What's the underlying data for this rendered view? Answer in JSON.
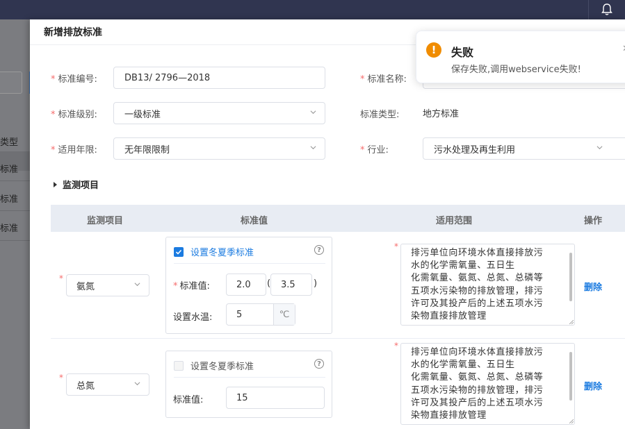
{
  "background": {
    "list_header": "类型",
    "rows": [
      "标准",
      "标准",
      "标准"
    ]
  },
  "drawer": {
    "title": "新增排放标准",
    "form": {
      "code_label": "标准编号:",
      "code_value": "DB13/ 2796—2018",
      "name_label": "标准名称:",
      "level_label": "标准级别:",
      "level_value": "一级标准",
      "type_label": "标准类型:",
      "type_value": "地方标准",
      "years_label": "适用年限:",
      "years_value": "无年限限制",
      "industry_label": "行业:",
      "industry_value": "污水处理及再生利用"
    },
    "section_title": "监测项目",
    "table": {
      "headers": [
        "监测项目",
        "标准值",
        "适用范围",
        "操作"
      ],
      "rows": [
        {
          "item": "氨氮",
          "winter_label": "设置冬夏季标准",
          "winter_checked": true,
          "value_label": "标准值:",
          "value_low": "2.0",
          "value_high": "3.5",
          "open_paren": "(",
          "close_paren": ")",
          "temp_label": "设置水温:",
          "temp_value": "5",
          "temp_unit": "℃",
          "scope_lines": [
            "排污单位向环境水体直接排放污",
            "水的化学需氧量、五日生",
            "化需氧量、氨氮、总氮、总磷等",
            "五项水污染物的排放管理，排污",
            "许可及其投产后的上述五项水污",
            "染物直接排放管理"
          ],
          "action": "删除"
        },
        {
          "item": "总氮",
          "winter_label": "设置冬夏季标准",
          "winter_checked": false,
          "value_label": "标准值:",
          "value": "15",
          "scope_lines": [
            "排污单位向环境水体直接排放污",
            "水的化学需氧量、五日生",
            "化需氧量、氨氮、总氮、总磷等",
            "五项水污染物的排放管理，排污",
            "许可及其投产后的上述五项水污",
            "染物直接排放管理"
          ],
          "action": "删除"
        }
      ]
    }
  },
  "notification": {
    "title": "失败",
    "message": "保存失败,调用webservice失败!",
    "icon": "warning-icon",
    "icon_color": "#f08c00"
  },
  "colors": {
    "topbar": "#303550",
    "accent": "#1b7be0",
    "required": "#f56c6c"
  }
}
